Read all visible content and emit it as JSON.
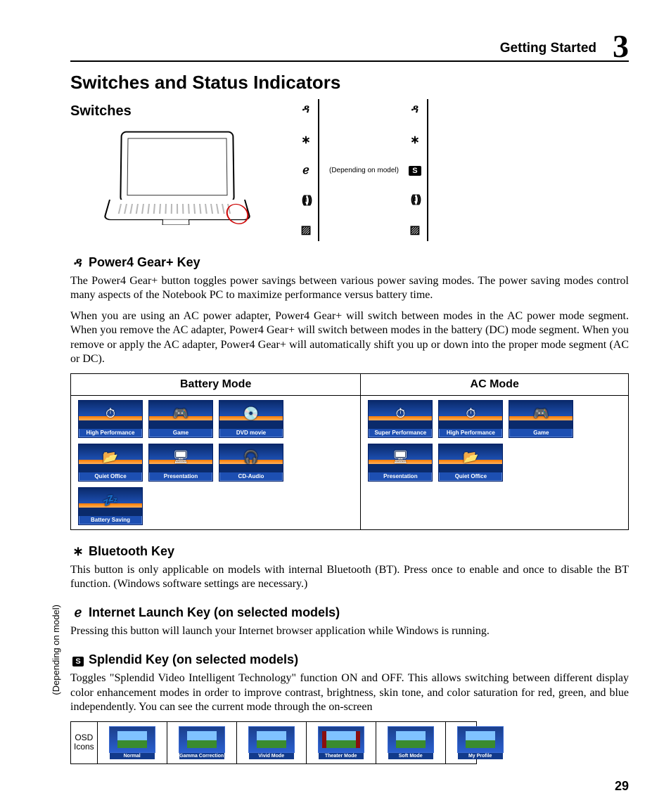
{
  "header": {
    "section": "Getting Started",
    "chapter": "3"
  },
  "page_number": "29",
  "h1": "Switches and Status Indicators",
  "h2": "Switches",
  "panel_note": "(Depending on model)",
  "side_note": "(Depending on model)",
  "icons": {
    "runner": "✨",
    "bt": "✱",
    "globe": "✎",
    "wifi_dot": "ı",
    "pad": "☒"
  },
  "power4": {
    "title": "Power4 Gear+ Key",
    "p1": "The Power4 Gear+ button toggles power savings between various power saving modes. The power saving modes control many aspects of the Notebook PC to maximize performance versus battery time.",
    "p2": "When you are using an AC power adapter, Power4 Gear+ will switch between modes in the AC power mode segment. When you remove the AC adapter, Power4 Gear+ will switch between modes in the battery (DC) mode segment. When you remove or apply the AC adapter, Power4 Gear+ will automatically shift you up or down into the proper mode segment (AC or DC)."
  },
  "mode_table": {
    "battery_hdr": "Battery Mode",
    "ac_hdr": "AC Mode",
    "battery": [
      {
        "label": "High Performance",
        "glyph": "⏱"
      },
      {
        "label": "Game",
        "glyph": "🎮"
      },
      {
        "label": "DVD movie",
        "glyph": "💿"
      },
      {
        "label": "Quiet Office",
        "glyph": "📂"
      },
      {
        "label": "Presentation",
        "glyph": "🖥"
      },
      {
        "label": "CD-Audio",
        "glyph": "🎧"
      },
      {
        "label": "Battery Saving",
        "glyph": "💤"
      }
    ],
    "ac": [
      {
        "label": "Super Performance",
        "glyph": "⏱"
      },
      {
        "label": "High Performance",
        "glyph": "⏱"
      },
      {
        "label": "Game",
        "glyph": "🎮"
      },
      {
        "label": "Presentation",
        "glyph": "🖥"
      },
      {
        "label": "Quiet Office",
        "glyph": "📂"
      }
    ]
  },
  "bluetooth": {
    "title": "Bluetooth Key",
    "p": "This button is only applicable on models with internal Bluetooth (BT). Press once to enable and once to disable the BT function. (Windows software settings are necessary.)"
  },
  "internet": {
    "title": "Internet Launch Key (on selected models)",
    "p": "Pressing this button will launch your Internet browser application while Windows is running."
  },
  "splendid": {
    "badge": "S",
    "title": "Splendid Key (on selected models)",
    "p": "Toggles \"Splendid Video Intelligent Technology\" function ON and OFF. This allows switching between different display color enhancement modes in order to improve contrast, brightness, skin tone, and color saturation for red, green, and blue independently. You can see the current mode through the on-screen"
  },
  "osd": {
    "caption": "OSD Icons",
    "items": [
      "Normal",
      "Gamma Correction",
      "Vivid Mode",
      "Theater Mode",
      "Soft Mode",
      "My Profile"
    ]
  }
}
